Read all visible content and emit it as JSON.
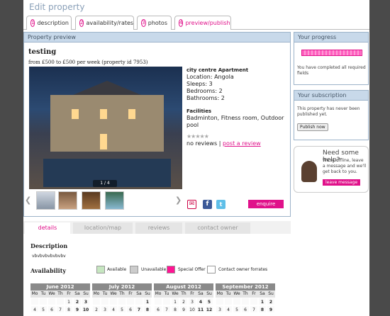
{
  "page_title": "Edit property",
  "steps": [
    {
      "num": "1",
      "label": "description"
    },
    {
      "num": "2",
      "label": "availability/rates"
    },
    {
      "num": "3",
      "label": "photos"
    },
    {
      "num": "4",
      "label": "preview/publish"
    }
  ],
  "preview": {
    "header": "Property preview",
    "title": "testing",
    "subtitle": "from £500 to £500 per week (property id 7953)",
    "photo_counter": "1 / 4",
    "info": {
      "name": "city centre Apartment",
      "location": "Location: Angola",
      "sleeps": "Sleeps: 3",
      "bedrooms": "Bedrooms: 2",
      "bathrooms": "Bathrooms: 2",
      "facilities_label": "Facilities",
      "facilities": "Badminton, Fitness room, Outdoor pool",
      "stars": "★★★★★",
      "reviews": "no reviews",
      "separator": "|",
      "post_review": "post a review"
    },
    "enquire_label": "enquire"
  },
  "progress": {
    "header": "Your progress",
    "percent": 100,
    "text": "You have completed all required fields"
  },
  "subscription": {
    "header": "Your subscription settings",
    "text": "This property has never been published yet.",
    "button": "Publish now"
  },
  "help": {
    "title": "Need some help?",
    "text": "We're offline, leave a message and we'll get back to you.",
    "button": "leave message"
  },
  "tabs": [
    "details",
    "location/map",
    "reviews",
    "contact owner"
  ],
  "description": {
    "heading": "Description",
    "text": "vbvbvbvbvbvbv"
  },
  "availability": {
    "heading": "Availability",
    "legend": [
      "Available",
      "Unavailable",
      "Special Offer",
      "Contact owner forrates"
    ],
    "colors": {
      "available": "#c6e6c0",
      "unavailable": "#cccccc",
      "special": "#ff1493",
      "contact": "#ffffff"
    },
    "day_headers": [
      "Mo",
      "Tu",
      "We",
      "Th",
      "Fr",
      "Sa",
      "Su"
    ],
    "months": [
      {
        "name": "June 2012",
        "rows": [
          [
            "",
            "",
            "",
            "",
            "1",
            "2",
            "3"
          ],
          [
            "4",
            "5",
            "6",
            "7",
            "8",
            "9",
            "10"
          ]
        ]
      },
      {
        "name": "July 2012",
        "rows": [
          [
            "",
            "",
            "",
            "",
            "",
            "",
            "1"
          ],
          [
            "2",
            "3",
            "4",
            "5",
            "6",
            "7",
            "8"
          ]
        ]
      },
      {
        "name": "August 2012",
        "rows": [
          [
            "",
            "",
            "1",
            "2",
            "3",
            "4",
            "5"
          ],
          [
            "6",
            "7",
            "8",
            "9",
            "10",
            "11",
            "12"
          ]
        ]
      },
      {
        "name": "September 2012",
        "rows": [
          [
            "",
            "",
            "",
            "",
            "",
            "1",
            "2"
          ],
          [
            "3",
            "4",
            "5",
            "6",
            "7",
            "8",
            "9"
          ]
        ]
      }
    ]
  }
}
